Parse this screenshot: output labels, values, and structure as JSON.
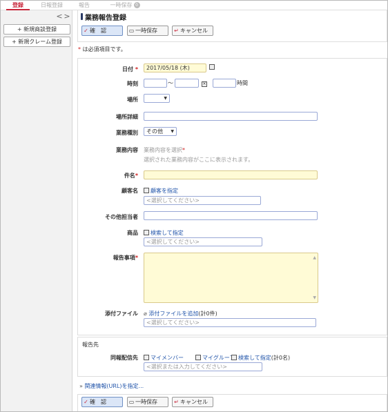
{
  "tabs": [
    {
      "label": "登録",
      "active": true
    },
    {
      "label": "日報登録",
      "active": false
    },
    {
      "label": "報告",
      "active": false
    },
    {
      "label": "一時保存",
      "active": false,
      "badge": "0"
    }
  ],
  "sidebar": {
    "prev": "<",
    "next": ">",
    "buttons": [
      "+ 新規商談登録",
      "+ 新規クレーム登録"
    ]
  },
  "page": {
    "title": "業務報告登録",
    "required_note": "は必須項目です。",
    "required_mark": "*"
  },
  "toolbar": {
    "confirm_label": "確　認",
    "save_label": "一時保存",
    "cancel_label": "キャンセル"
  },
  "form": {
    "date": {
      "label": "日付",
      "value": "2017/05/18 (木)"
    },
    "time": {
      "label": "時刻",
      "separator": "～",
      "unit": "時間"
    },
    "place": {
      "label": "場所"
    },
    "place_detail": {
      "label": "場所詳細"
    },
    "work_type": {
      "label": "業務種別",
      "value": "その他"
    },
    "work_content": {
      "label": "業務内容",
      "placeholder": "業務内容を選択",
      "hint": "選択された業務内容がここに表示されます。"
    },
    "subject": {
      "label": "件名"
    },
    "customer": {
      "label": "顧客名",
      "link": "顧客を指定",
      "placeholder": "<選択してください>"
    },
    "other_staff": {
      "label": "その他担当者"
    },
    "product": {
      "label": "商品",
      "link": "検索して指定",
      "placeholder": "<選択してください>"
    },
    "report": {
      "label": "報告事項"
    },
    "attachment": {
      "label": "添付ファイル",
      "link": "添付ファイルを追加",
      "count": "(計0件)",
      "placeholder": "<選択してください>"
    }
  },
  "report_to": {
    "section": "報告先",
    "label": "同報配信先",
    "my_members": "マイメンバー",
    "my_groups": "マイグループ",
    "search": "検索して指定",
    "count": "(計0名)",
    "placeholder": "<選択または入力してください>"
  },
  "related_link": "関連情報(URL)を指定..."
}
